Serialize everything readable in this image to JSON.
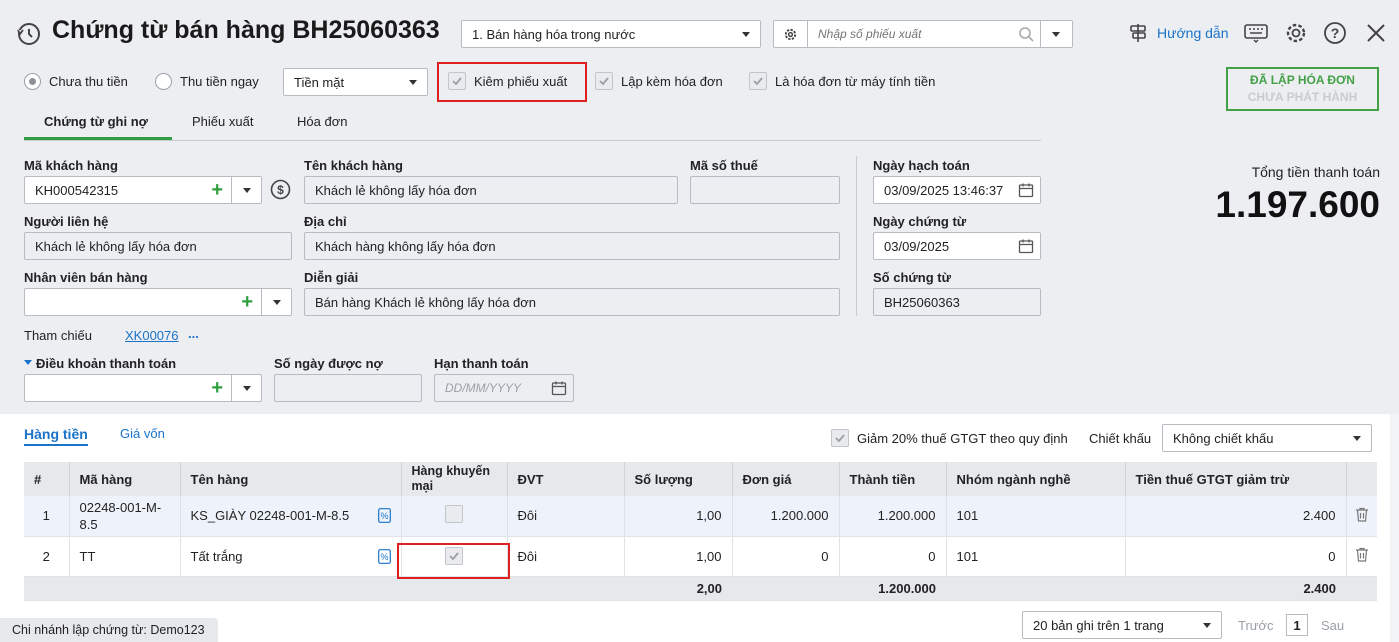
{
  "header": {
    "title": "Chứng từ bán hàng BH25060363",
    "type_select": "1. Bán hàng hóa trong nước",
    "search_placeholder": "Nhập số phiếu xuất",
    "help_label": "Hướng dẫn"
  },
  "options": {
    "radio_unpaid": "Chưa thu tiền",
    "radio_paid": "Thu tiền ngay",
    "payment_method": "Tiền mặt",
    "check_export": "Kiêm phiếu xuất",
    "check_invoice": "Lập kèm hóa đơn",
    "check_cash_register": "Là hóa đơn từ máy tính tiền"
  },
  "status": {
    "line1": "ĐÃ LẬP HÓA ĐƠN",
    "line2": "CHƯA PHÁT HÀNH"
  },
  "tabs": [
    "Chứng từ ghi nợ",
    "Phiếu xuất",
    "Hóa đơn"
  ],
  "form": {
    "customer_code_label": "Mã khách hàng",
    "customer_code": "KH000542315",
    "customer_name_label": "Tên khách hàng",
    "customer_name": "Khách lẻ không lấy hóa đơn",
    "tax_code_label": "Mã số thuế",
    "tax_code": "",
    "posting_date_label": "Ngày hạch toán",
    "posting_date": "03/09/2025 13:46:37",
    "contact_label": "Người liên hệ",
    "contact": "Khách lẻ không lấy hóa đơn",
    "address_label": "Địa chỉ",
    "address": "Khách hàng không lấy hóa đơn",
    "voucher_date_label": "Ngày chứng từ",
    "voucher_date": "03/09/2025",
    "sales_staff_label": "Nhân viên bán hàng",
    "sales_staff": "",
    "description_label": "Diễn giải",
    "description": "Bán hàng Khách lẻ không lấy hóa đơn",
    "voucher_no_label": "Số chứng từ",
    "voucher_no": "BH25060363",
    "reference_label": "Tham chiếu",
    "reference_link": "XK00076",
    "reference_more": "...",
    "payment_terms_label": "Điều khoản thanh toán",
    "credit_days_label": "Số ngày được nợ",
    "due_date_label": "Hạn thanh toán",
    "due_date_placeholder": "DD/MM/YYYY"
  },
  "total": {
    "label": "Tổng tiền thanh toán",
    "value": "1.197.600"
  },
  "detail": {
    "tabs": [
      "Hàng tiền",
      "Giá vốn"
    ],
    "vat_reduce_label": "Giảm 20% thuế GTGT theo quy định",
    "discount_label": "Chiết khấu",
    "discount_value": "Không chiết khấu",
    "columns": [
      "#",
      "Mã hàng",
      "Tên hàng",
      "Hàng khuyến mại",
      "ĐVT",
      "Số lượng",
      "Đơn giá",
      "Thành tiền",
      "Nhóm ngành nghề",
      "Tiền thuế GTGT giảm trừ"
    ],
    "rows": [
      {
        "no": "1",
        "code": "02248-001-M-8.5",
        "name": "KS_GIÀY 02248-001-M-8.5",
        "promo": false,
        "unit": "Đôi",
        "qty": "1,00",
        "price": "1.200.000",
        "amount": "1.200.000",
        "group": "101",
        "vat": "2.400"
      },
      {
        "no": "2",
        "code": "TT",
        "name": "Tất trắng",
        "promo": true,
        "unit": "Đôi",
        "qty": "1,00",
        "price": "0",
        "amount": "0",
        "group": "101",
        "vat": "0"
      }
    ],
    "footer": {
      "qty": "2,00",
      "amount": "1.200.000",
      "vat": "2.400"
    }
  },
  "footer_bar": {
    "branch": "Chi nhánh lập chứng từ: Demo123",
    "page_size": "20 bản ghi trên 1 trang",
    "prev": "Trước",
    "page": "1",
    "next": "Sau"
  }
}
